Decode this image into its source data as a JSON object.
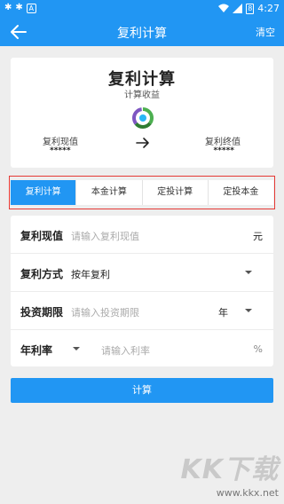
{
  "status_bar": {
    "left_icons": [
      "bug-icon",
      "bug-icon",
      "a-icon"
    ],
    "battery_level": "8",
    "time": "4:27"
  },
  "app_bar": {
    "title": "复利计算",
    "action_label": "清空"
  },
  "summary": {
    "title": "复利计算",
    "subtitle": "计算收益",
    "present_value_label": "复利现值",
    "present_value": "*****",
    "future_value_label": "复利终值",
    "future_value": "*****"
  },
  "tabs": [
    {
      "label": "复利计算",
      "active": true
    },
    {
      "label": "本金计算",
      "active": false
    },
    {
      "label": "定投计算",
      "active": false
    },
    {
      "label": "定投本金",
      "active": false
    }
  ],
  "form": {
    "present_value": {
      "label": "复利现值",
      "placeholder": "请输入复利现值",
      "unit": "元"
    },
    "compound_mode": {
      "label": "复利方式",
      "value": "按年复利"
    },
    "period": {
      "label": "投资期限",
      "placeholder": "请输入投资期限",
      "unit": "年"
    },
    "rate": {
      "label": "年利率",
      "placeholder": "请输入利率",
      "unit": "%"
    }
  },
  "calculate_label": "计算",
  "watermark": {
    "main": "KK下载",
    "url": "www.kkx.net"
  },
  "colors": {
    "primary": "#2196f3",
    "highlight_frame": "#e53935"
  }
}
